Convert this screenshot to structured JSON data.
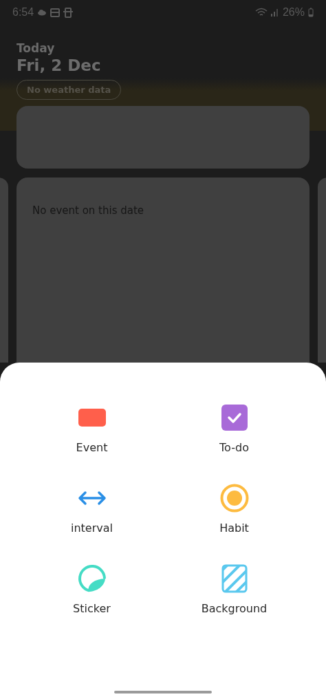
{
  "status_bar": {
    "time": "6:54",
    "battery": "26%"
  },
  "header": {
    "label": "Today",
    "date": "Fri, 2 Dec",
    "weather": "No weather data"
  },
  "event_card": {
    "empty_text": "No event on this date"
  },
  "add_sheet": {
    "items": [
      {
        "kind": "event",
        "label": "Event"
      },
      {
        "kind": "todo",
        "label": "To-do"
      },
      {
        "kind": "interval",
        "label": "interval"
      },
      {
        "kind": "habit",
        "label": "Habit"
      },
      {
        "kind": "sticker",
        "label": "Sticker"
      },
      {
        "kind": "background",
        "label": "Background"
      }
    ]
  }
}
